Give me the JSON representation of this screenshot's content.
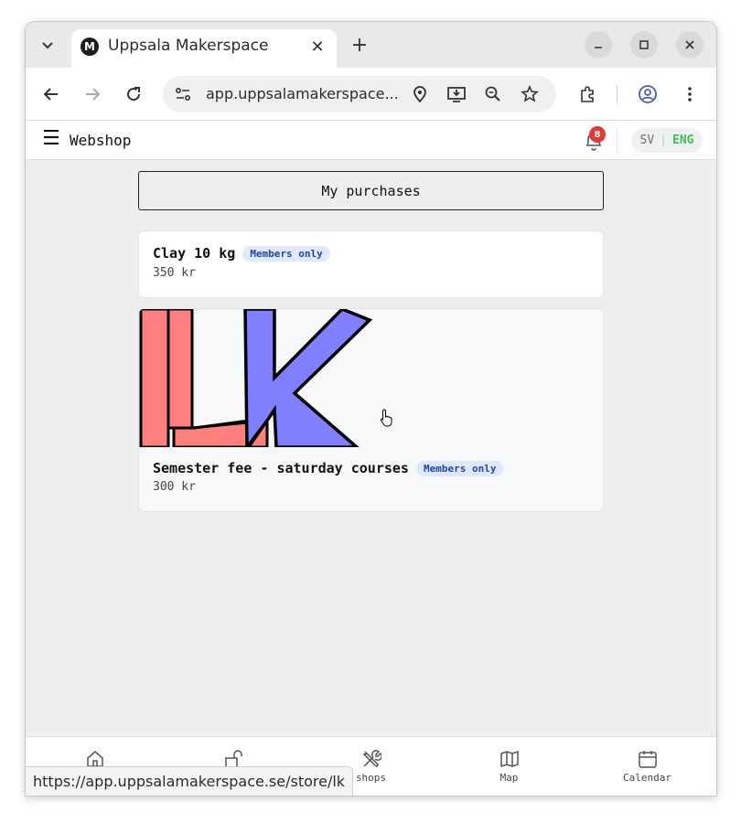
{
  "browser": {
    "tab_title": "Uppsala Makerspace",
    "favicon_letter": "M",
    "url_display": "app.uppsalamakerspace...",
    "status_url": "https://app.uppsalamakerspace.se/store/lk"
  },
  "app": {
    "title": "Webshop",
    "notification_count": "8",
    "lang_sv": "SV",
    "lang_divider": "|",
    "lang_eng": "ENG",
    "my_purchases_label": "My purchases"
  },
  "products": [
    {
      "name": "Clay 10 kg",
      "badge": "Members only",
      "price": "350 kr"
    },
    {
      "name": "Semester fee - saturday courses",
      "badge": "Members only",
      "price": "300 kr",
      "image": "lk-logo"
    }
  ],
  "bottom_nav": [
    {
      "label": "",
      "icon": "home-icon"
    },
    {
      "label": "",
      "icon": "unlock-icon"
    },
    {
      "label": "shops",
      "icon": "tools-icon"
    },
    {
      "label": "Map",
      "icon": "map-icon"
    },
    {
      "label": "Calendar",
      "icon": "calendar-icon"
    }
  ],
  "colors": {
    "accent_green": "#3fbf56",
    "badge_bg": "#dfe9fb",
    "badge_text": "#2046a8",
    "notification_red": "#e53935",
    "lk_red": "#ff7f7f",
    "lk_blue": "#8080ff"
  }
}
